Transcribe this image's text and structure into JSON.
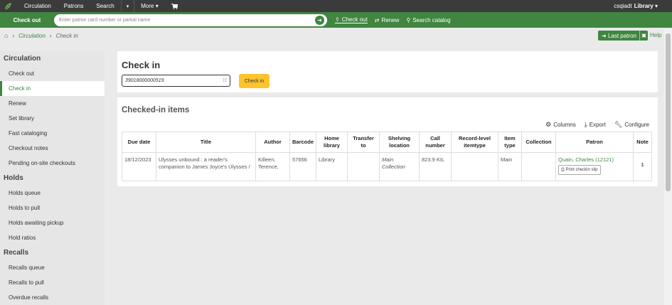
{
  "topnav": {
    "items": [
      "Circulation",
      "Patrons",
      "Search",
      "More"
    ],
    "user_prefix": "csqiadt",
    "user_library": "Library"
  },
  "greenbar": {
    "label": "Check out",
    "placeholder": "Enter patron card number or partial name",
    "links": [
      {
        "label": "Check out",
        "icon": "upload-icon"
      },
      {
        "label": "Renew",
        "icon": "renew-icon"
      },
      {
        "label": "Search catalog",
        "icon": "search-icon"
      }
    ]
  },
  "breadcrumb": {
    "items": [
      "Circulation",
      "Check in"
    ]
  },
  "last_patron_label": "Last patron",
  "help_label": "Help",
  "sidebar": {
    "sections": [
      {
        "heading": "Circulation",
        "items": [
          "Check out",
          "Check in",
          "Renew",
          "Set library",
          "Fast cataloging",
          "Checkout notes",
          "Pending on-site checkouts"
        ]
      },
      {
        "heading": "Holds",
        "items": [
          "Holds queue",
          "Holds to pull",
          "Holds awaiting pickup",
          "Hold ratios"
        ]
      },
      {
        "heading": "Recalls",
        "items": [
          "Recalls queue",
          "Recalls to pull",
          "Overdue recalls"
        ]
      }
    ],
    "active": "Check in"
  },
  "checkin": {
    "title": "Check in",
    "input_value": "39018000000519",
    "button_label": "Check in"
  },
  "checked_in": {
    "title": "Checked-in items",
    "toolbar": [
      "Columns",
      "Export",
      "Configure"
    ],
    "headers": [
      [
        "Due date"
      ],
      [
        "Title"
      ],
      [
        "Author"
      ],
      [
        "Barcode"
      ],
      [
        "Home",
        "library"
      ],
      [
        "Transfer",
        "to"
      ],
      [
        "Shelving",
        "location"
      ],
      [
        "Call",
        "number"
      ],
      [
        "Record-level",
        "itemtype"
      ],
      [
        "Item",
        "type"
      ],
      [
        "Collection"
      ],
      [
        "Patron"
      ],
      [
        "Note"
      ]
    ],
    "row": {
      "due_date": "18/12/2023",
      "title": "Ulysses unbound : a reader's companion to James Joyce's Ulysses /",
      "author": "Killeen, Terence,",
      "barcode": "57656",
      "home_library": "Library",
      "transfer_to": "",
      "shelving_location": "Main Collection",
      "call_number": "823.9 KIL",
      "record_itemtype": "",
      "item_type": "Main",
      "collection": "",
      "patron": "Quain, Charles (12121)",
      "print_slip": "Print checkin slip",
      "note": "1"
    }
  },
  "colors": {
    "topnav": "#3b3b3b",
    "accent_green": "#408540",
    "checkin_button": "#ffc32b"
  }
}
